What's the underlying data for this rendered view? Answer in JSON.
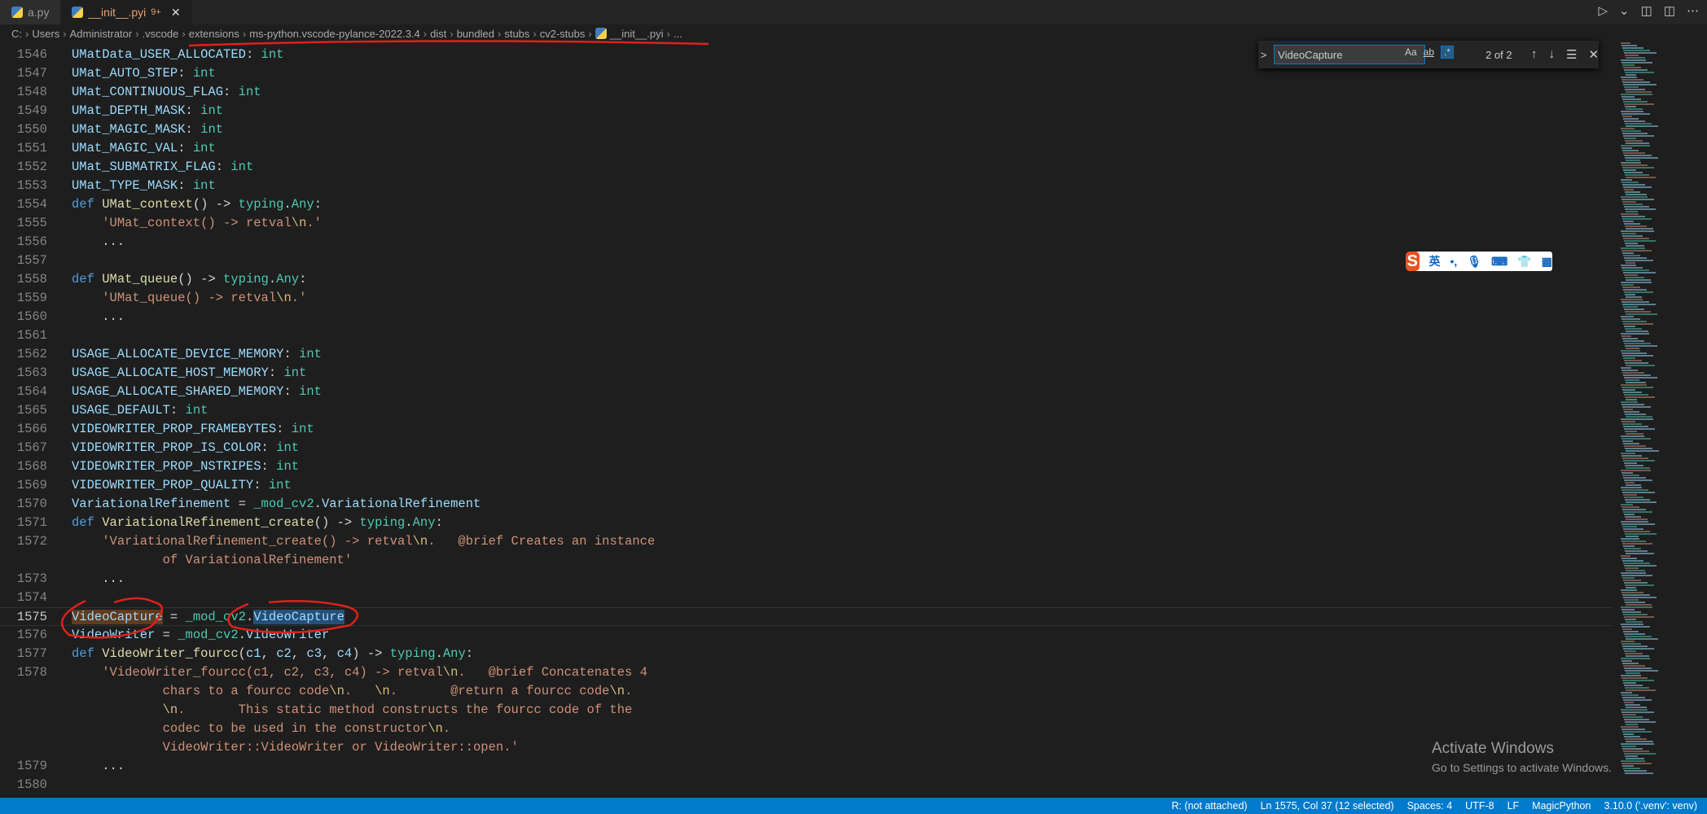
{
  "tabs": [
    {
      "label": "a.py",
      "active": false
    },
    {
      "label": "__init__.pyi",
      "badge": "9+",
      "active": true,
      "close": "✕"
    }
  ],
  "title_actions": {
    "run": "▷",
    "run_more": "⌄",
    "open_preview": "◫",
    "split": "◫",
    "more": "⋯"
  },
  "breadcrumb": [
    "C:",
    "Users",
    "Administrator",
    ".vscode",
    "extensions",
    "ms-python.vscode-pylance-2022.3.4",
    "dist",
    "bundled",
    "stubs",
    "cv2-stubs",
    "__init__.pyi",
    "..."
  ],
  "find": {
    "toggle": ">",
    "value": "VideoCapture",
    "match_case": "Aa",
    "whole_word": "ab",
    "regex": ".*",
    "count": "2 of 2",
    "prev": "↑",
    "next": "↓",
    "in_selection": "☰",
    "close": "✕"
  },
  "ime": {
    "logo": "S",
    "lang": "英",
    "punct": "•,",
    "mic": "🎙",
    "keyboard": "⌨",
    "skin": "👕",
    "tools": "▦"
  },
  "activate_windows": {
    "title": "Activate Windows",
    "subtitle": "Go to Settings to activate Windows."
  },
  "status": [
    "R: (not attached)",
    "Ln 1575, Col 37 (12 selected)",
    "Spaces: 4",
    "UTF-8",
    "LF",
    "MagicPython",
    "3.10.0 ('.venv': venv)"
  ],
  "colors": {
    "accent": "#007acc",
    "annotation": "#e0201b"
  },
  "current_line": "1575",
  "lines": [
    {
      "n": "1546",
      "t": [
        [
          "var",
          "UMatData_USER_ALLOCATED"
        ],
        [
          "plain",
          ": "
        ],
        [
          "type",
          "int"
        ]
      ]
    },
    {
      "n": "1547",
      "t": [
        [
          "var",
          "UMat_AUTO_STEP"
        ],
        [
          "plain",
          ": "
        ],
        [
          "type",
          "int"
        ]
      ]
    },
    {
      "n": "1548",
      "t": [
        [
          "var",
          "UMat_CONTINUOUS_FLAG"
        ],
        [
          "plain",
          ": "
        ],
        [
          "type",
          "int"
        ]
      ]
    },
    {
      "n": "1549",
      "t": [
        [
          "var",
          "UMat_DEPTH_MASK"
        ],
        [
          "plain",
          ": "
        ],
        [
          "type",
          "int"
        ]
      ]
    },
    {
      "n": "1550",
      "t": [
        [
          "var",
          "UMat_MAGIC_MASK"
        ],
        [
          "plain",
          ": "
        ],
        [
          "type",
          "int"
        ]
      ]
    },
    {
      "n": "1551",
      "t": [
        [
          "var",
          "UMat_MAGIC_VAL"
        ],
        [
          "plain",
          ": "
        ],
        [
          "type",
          "int"
        ]
      ]
    },
    {
      "n": "1552",
      "t": [
        [
          "var",
          "UMat_SUBMATRIX_FLAG"
        ],
        [
          "plain",
          ": "
        ],
        [
          "type",
          "int"
        ]
      ]
    },
    {
      "n": "1553",
      "t": [
        [
          "var",
          "UMat_TYPE_MASK"
        ],
        [
          "plain",
          ": "
        ],
        [
          "type",
          "int"
        ]
      ]
    },
    {
      "n": "1554",
      "t": [
        [
          "kw",
          "def "
        ],
        [
          "fn",
          "UMat_context"
        ],
        [
          "plain",
          "() -> "
        ],
        [
          "type",
          "typing"
        ],
        [
          "plain",
          "."
        ],
        [
          "type",
          "Any"
        ],
        [
          "plain",
          ":"
        ]
      ]
    },
    {
      "n": "1555",
      "t": [
        [
          "plain",
          "    "
        ],
        [
          "str",
          "'UMat_context() -> retval"
        ],
        [
          "esc",
          "\\n"
        ],
        [
          "str",
          ".'"
        ]
      ]
    },
    {
      "n": "1556",
      "t": [
        [
          "plain",
          "    ..."
        ]
      ]
    },
    {
      "n": "1557",
      "t": []
    },
    {
      "n": "1558",
      "t": [
        [
          "kw",
          "def "
        ],
        [
          "fn",
          "UMat_queue"
        ],
        [
          "plain",
          "() -> "
        ],
        [
          "type",
          "typing"
        ],
        [
          "plain",
          "."
        ],
        [
          "type",
          "Any"
        ],
        [
          "plain",
          ":"
        ]
      ]
    },
    {
      "n": "1559",
      "t": [
        [
          "plain",
          "    "
        ],
        [
          "str",
          "'UMat_queue() -> retval"
        ],
        [
          "esc",
          "\\n"
        ],
        [
          "str",
          ".'"
        ]
      ]
    },
    {
      "n": "1560",
      "t": [
        [
          "plain",
          "    ..."
        ]
      ]
    },
    {
      "n": "1561",
      "t": []
    },
    {
      "n": "1562",
      "t": [
        [
          "var",
          "USAGE_ALLOCATE_DEVICE_MEMORY"
        ],
        [
          "plain",
          ": "
        ],
        [
          "type",
          "int"
        ]
      ]
    },
    {
      "n": "1563",
      "t": [
        [
          "var",
          "USAGE_ALLOCATE_HOST_MEMORY"
        ],
        [
          "plain",
          ": "
        ],
        [
          "type",
          "int"
        ]
      ]
    },
    {
      "n": "1564",
      "t": [
        [
          "var",
          "USAGE_ALLOCATE_SHARED_MEMORY"
        ],
        [
          "plain",
          ": "
        ],
        [
          "type",
          "int"
        ]
      ]
    },
    {
      "n": "1565",
      "t": [
        [
          "var",
          "USAGE_DEFAULT"
        ],
        [
          "plain",
          ": "
        ],
        [
          "type",
          "int"
        ]
      ]
    },
    {
      "n": "1566",
      "t": [
        [
          "var",
          "VIDEOWRITER_PROP_FRAMEBYTES"
        ],
        [
          "plain",
          ": "
        ],
        [
          "type",
          "int"
        ]
      ]
    },
    {
      "n": "1567",
      "t": [
        [
          "var",
          "VIDEOWRITER_PROP_IS_COLOR"
        ],
        [
          "plain",
          ": "
        ],
        [
          "type",
          "int"
        ]
      ]
    },
    {
      "n": "1568",
      "t": [
        [
          "var",
          "VIDEOWRITER_PROP_NSTRIPES"
        ],
        [
          "plain",
          ": "
        ],
        [
          "type",
          "int"
        ]
      ]
    },
    {
      "n": "1569",
      "t": [
        [
          "var",
          "VIDEOWRITER_PROP_QUALITY"
        ],
        [
          "plain",
          ": "
        ],
        [
          "type",
          "int"
        ]
      ]
    },
    {
      "n": "1570",
      "t": [
        [
          "var",
          "VariationalRefinement"
        ],
        [
          "plain",
          " = "
        ],
        [
          "type",
          "_mod_cv2"
        ],
        [
          "plain",
          "."
        ],
        [
          "var",
          "VariationalRefinement"
        ]
      ]
    },
    {
      "n": "1571",
      "t": [
        [
          "kw",
          "def "
        ],
        [
          "fn",
          "VariationalRefinement_create"
        ],
        [
          "plain",
          "() -> "
        ],
        [
          "type",
          "typing"
        ],
        [
          "plain",
          "."
        ],
        [
          "type",
          "Any"
        ],
        [
          "plain",
          ":"
        ]
      ]
    },
    {
      "n": "1572",
      "t": [
        [
          "plain",
          "    "
        ],
        [
          "str",
          "'VariationalRefinement_create() -> retval"
        ],
        [
          "esc",
          "\\n"
        ],
        [
          "str",
          ".   @brief Creates an instance"
        ]
      ]
    },
    {
      "n": "",
      "t": [
        [
          "plain",
          "            "
        ],
        [
          "str",
          "of VariationalRefinement'"
        ]
      ]
    },
    {
      "n": "1573",
      "t": [
        [
          "plain",
          "    ..."
        ]
      ]
    },
    {
      "n": "1574",
      "t": []
    },
    {
      "n": "1575",
      "t": [
        [
          "sel1",
          "VideoCapture"
        ],
        [
          "plain",
          " = "
        ],
        [
          "type",
          "_mod_cv2"
        ],
        [
          "plain",
          "."
        ],
        [
          "sel2",
          "VideoCapture"
        ]
      ]
    },
    {
      "n": "1576",
      "t": [
        [
          "var",
          "VideoWriter"
        ],
        [
          "plain",
          " = "
        ],
        [
          "type",
          "_mod_cv2"
        ],
        [
          "plain",
          "."
        ],
        [
          "var",
          "VideoWriter"
        ]
      ]
    },
    {
      "n": "1577",
      "t": [
        [
          "kw",
          "def "
        ],
        [
          "fn",
          "VideoWriter_fourcc"
        ],
        [
          "plain",
          "("
        ],
        [
          "var",
          "c1"
        ],
        [
          "plain",
          ", "
        ],
        [
          "var",
          "c2"
        ],
        [
          "plain",
          ", "
        ],
        [
          "var",
          "c3"
        ],
        [
          "plain",
          ", "
        ],
        [
          "var",
          "c4"
        ],
        [
          "plain",
          ") -> "
        ],
        [
          "type",
          "typing"
        ],
        [
          "plain",
          "."
        ],
        [
          "type",
          "Any"
        ],
        [
          "plain",
          ":"
        ]
      ]
    },
    {
      "n": "1578",
      "t": [
        [
          "plain",
          "    "
        ],
        [
          "str",
          "'VideoWriter_fourcc(c1, c2, c3, c4) -> retval"
        ],
        [
          "esc",
          "\\n"
        ],
        [
          "str",
          ".   @brief Concatenates 4"
        ]
      ]
    },
    {
      "n": "",
      "t": [
        [
          "plain",
          "            "
        ],
        [
          "str",
          "chars to a fourcc code"
        ],
        [
          "esc",
          "\\n"
        ],
        [
          "str",
          ".   "
        ],
        [
          "esc",
          "\\n"
        ],
        [
          "str",
          ".       @return a fourcc code"
        ],
        [
          "esc",
          "\\n"
        ],
        [
          "str",
          "."
        ]
      ]
    },
    {
      "n": "",
      "t": [
        [
          "plain",
          "            "
        ],
        [
          "esc",
          "\\n"
        ],
        [
          "str",
          ".       This static method constructs the fourcc code of the"
        ]
      ]
    },
    {
      "n": "",
      "t": [
        [
          "plain",
          "            "
        ],
        [
          "str",
          "codec to be used in the constructor"
        ],
        [
          "esc",
          "\\n"
        ],
        [
          "str",
          "."
        ]
      ]
    },
    {
      "n": "",
      "t": [
        [
          "plain",
          "            "
        ],
        [
          "str",
          "VideoWriter::VideoWriter or VideoWriter::open.'"
        ]
      ]
    },
    {
      "n": "1579",
      "t": [
        [
          "plain",
          "    ..."
        ]
      ]
    },
    {
      "n": "1580",
      "t": []
    }
  ]
}
